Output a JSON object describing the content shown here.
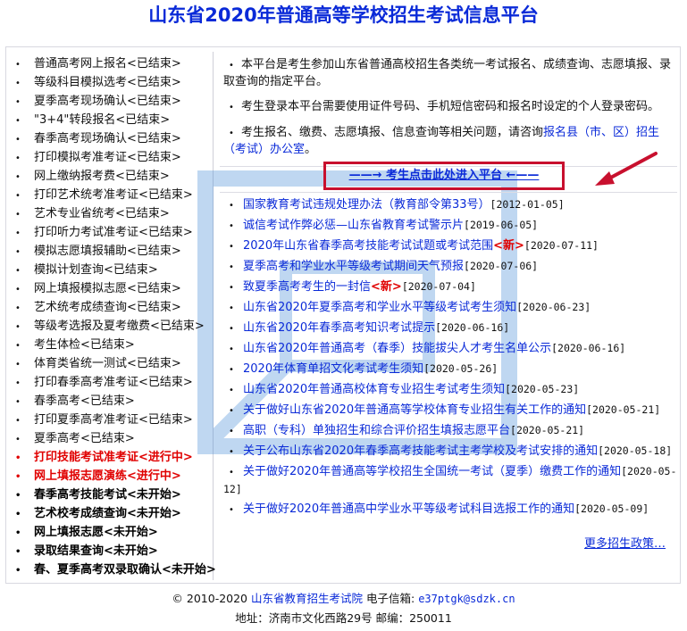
{
  "header": {
    "title": "山东省2020年普通高等学校招生考试信息平台"
  },
  "menu": [
    {
      "label": "普通高考网上报名<已结束>",
      "state": "ended"
    },
    {
      "label": "等级科目模拟选考<已结束>",
      "state": "ended"
    },
    {
      "label": "夏季高考现场确认<已结束>",
      "state": "ended"
    },
    {
      "label": "\"3+4\"转段报名<已结束>",
      "state": "ended"
    },
    {
      "label": "春季高考现场确认<已结束>",
      "state": "ended"
    },
    {
      "label": "打印模拟考准考证<已结束>",
      "state": "ended"
    },
    {
      "label": "网上缴纳报考费<已结束>",
      "state": "ended"
    },
    {
      "label": "打印艺术统考准考证<已结束>",
      "state": "ended"
    },
    {
      "label": "艺术专业省统考<已结束>",
      "state": "ended"
    },
    {
      "label": "打印听力考试准考证<已结束>",
      "state": "ended"
    },
    {
      "label": "模拟志愿填报辅助<已结束>",
      "state": "ended"
    },
    {
      "label": "模拟计划查询<已结束>",
      "state": "ended"
    },
    {
      "label": "网上填报模拟志愿<已结束>",
      "state": "ended"
    },
    {
      "label": "艺术统考成绩查询<已结束>",
      "state": "ended"
    },
    {
      "label": "等级考选报及夏考缴费<已结束>",
      "state": "ended"
    },
    {
      "label": "考生体检<已结束>",
      "state": "ended"
    },
    {
      "label": "体育类省统一测试<已结束>",
      "state": "ended"
    },
    {
      "label": "打印春季高考准考证<已结束>",
      "state": "ended"
    },
    {
      "label": "春季高考<已结束>",
      "state": "ended"
    },
    {
      "label": "打印夏季高考准考证<已结束>",
      "state": "ended"
    },
    {
      "label": "夏季高考<已结束>",
      "state": "ended"
    },
    {
      "label": "打印技能考试准考证<进行中>",
      "state": "active"
    },
    {
      "label": "网上填报志愿演练<进行中>",
      "state": "active"
    },
    {
      "label": "春季高考技能考试<未开始>",
      "state": "pending"
    },
    {
      "label": "艺术校考成绩查询<未开始>",
      "state": "pending"
    },
    {
      "label": "网上填报志愿<未开始>",
      "state": "pending"
    },
    {
      "label": "录取结果查询<未开始>",
      "state": "pending"
    },
    {
      "label": "春、夏季高考双录取确认<未开始>",
      "state": "pending"
    }
  ],
  "notices": {
    "n1": "本平台是考生参加山东省普通高校招生各类统一考试报名、成绩查询、志愿填报、录取查询的指定平台。",
    "n2": "考生登录本平台需要使用证件号码、手机短信密码和报名时设定的个人登录密码。",
    "n3_prefix": "考生报名、缴费、志愿填报、信息查询等相关问题，请咨询",
    "n3_link": "报名县（市、区）招生（考试）办公室",
    "n3_suffix": "。"
  },
  "enter": {
    "label": "——→ 考生点击此处进入平台 ←——"
  },
  "news": [
    {
      "title": "国家教育考试违规处理办法（教育部令第33号）",
      "date": "[2012-01-05]",
      "isNew": false
    },
    {
      "title": "诚信考试作弊必惩—山东省教育考试警示片",
      "date": "[2019-06-05]",
      "isNew": false
    },
    {
      "title": "2020年山东省春季高考技能考试试题或考试范围",
      "date": "[2020-07-11]",
      "isNew": true
    },
    {
      "title": "夏季高考和学业水平等级考试期间天气预报",
      "date": "[2020-07-06]",
      "isNew": false
    },
    {
      "title": "致夏季高考考生的一封信",
      "date": "[2020-07-04]",
      "isNew": true
    },
    {
      "title": "山东省2020年夏季高考和学业水平等级考试考生须知",
      "date": "[2020-06-23]",
      "isNew": false
    },
    {
      "title": "山东省2020年春季高考知识考试提示",
      "date": "[2020-06-16]",
      "isNew": false
    },
    {
      "title": "山东省2020年普通高考（春季）技能拔尖人才考生名单公示",
      "date": "[2020-06-16]",
      "isNew": false
    },
    {
      "title": "2020年体育单招文化考试考生须知",
      "date": "[2020-05-26]",
      "isNew": false
    },
    {
      "title": "山东省2020年普通高校体育专业招生考试考生须知",
      "date": "[2020-05-23]",
      "isNew": false
    },
    {
      "title": "关于做好山东省2020年普通高等学校体育专业招生有关工作的通知",
      "date": "[2020-05-21]",
      "isNew": false
    },
    {
      "title": "高职（专科）单独招生和综合评价招生填报志愿平台",
      "date": "[2020-05-21]",
      "isNew": false
    },
    {
      "title": "关于公布山东省2020年春季高考技能考试主考学校及考试安排的通知",
      "date": "[2020-05-18]",
      "isNew": false
    },
    {
      "title": "关于做好2020年普通高等学校招生全国统一考试（夏季）缴费工作的通知",
      "date": "[2020-05-12]",
      "isNew": false
    },
    {
      "title": "关于做好2020年普通高中学业水平等级考试科目选报工作的通知",
      "date": "[2020-05-09]",
      "isNew": false
    }
  ],
  "more": {
    "label": "更多招生政策…"
  },
  "footer": {
    "copyright": "© 2010-2020",
    "org": "山东省教育招生考试院",
    "email_label": "电子信箱:",
    "email": "e37ptgk@sdzk.cn",
    "address": "地址：济南市文化西路29号  邮编：250011"
  },
  "new_tag": "<新>",
  "colors": {
    "title": "#0a2ad8",
    "link": "#0a2ad8",
    "active": "#e00000",
    "highlight_box": "#c8102e"
  }
}
